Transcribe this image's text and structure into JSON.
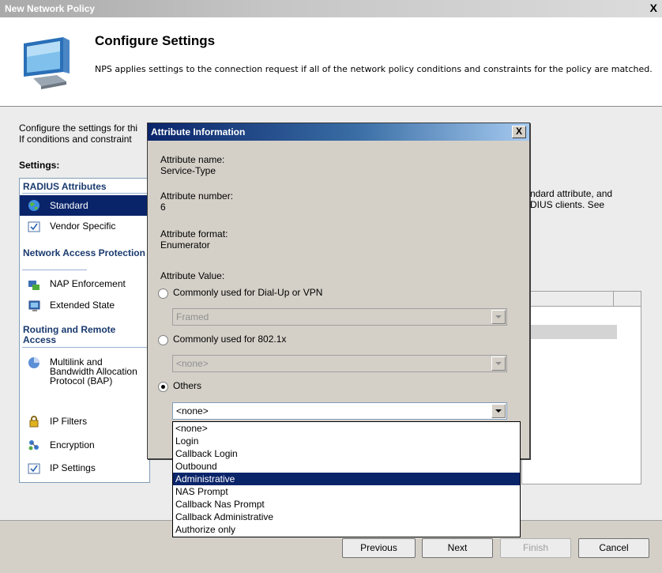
{
  "window": {
    "title": "New Network Policy",
    "close": "X"
  },
  "header": {
    "title": "Configure Settings",
    "description": "NPS applies settings to the connection request if all of the network policy conditions and constraints for the policy are matched."
  },
  "main": {
    "intro_line1": "Configure the settings for thi",
    "intro_line2": "If conditions and constraint",
    "settings_label": "Settings:",
    "right_text_line1": "ndard attribute, and",
    "right_text_line2": "DIUS clients. See"
  },
  "sidebar": {
    "sections": [
      {
        "label": "RADIUS Attributes"
      },
      {
        "label": "Network Access Protection"
      },
      {
        "label": "Routing and Remote Access"
      }
    ],
    "items": [
      {
        "label": "Standard",
        "icon": "globe-icon",
        "selected": true
      },
      {
        "label": "Vendor Specific",
        "icon": "checklist-icon"
      },
      {
        "label": "NAP Enforcement",
        "icon": "nap-icon"
      },
      {
        "label": "Extended State",
        "icon": "monitor-icon"
      },
      {
        "label": "Multilink and Bandwidth Allocation Protocol (BAP)",
        "icon": "multilink-icon"
      },
      {
        "label": "IP Filters",
        "icon": "lock-icon"
      },
      {
        "label": "Encryption",
        "icon": "encryption-icon"
      },
      {
        "label": "IP Settings",
        "icon": "checklist-icon"
      }
    ]
  },
  "buttons": {
    "previous": "Previous",
    "next": "Next",
    "finish": "Finish",
    "cancel": "Cancel"
  },
  "dialog": {
    "title": "Attribute Information",
    "close": "X",
    "attr_name_label": "Attribute name:",
    "attr_name_value": "Service-Type",
    "attr_number_label": "Attribute number:",
    "attr_number_value": "6",
    "attr_format_label": "Attribute format:",
    "attr_format_value": "Enumerator",
    "attr_value_label": "Attribute Value:",
    "radio_dialup": "Commonly used for Dial-Up or VPN",
    "combo_dialup": "Framed",
    "radio_8021x": "Commonly used for 802.1x",
    "combo_8021x": "<none>",
    "radio_others": "Others",
    "selected_radio": "Others",
    "combo_others": "<none>",
    "dropdown_options": [
      "<none>",
      "Login",
      "Callback Login",
      "Outbound",
      "Administrative",
      "NAS Prompt",
      "Callback Nas Prompt",
      "Callback Administrative",
      "Authorize only"
    ],
    "highlighted_option": "Administrative"
  }
}
